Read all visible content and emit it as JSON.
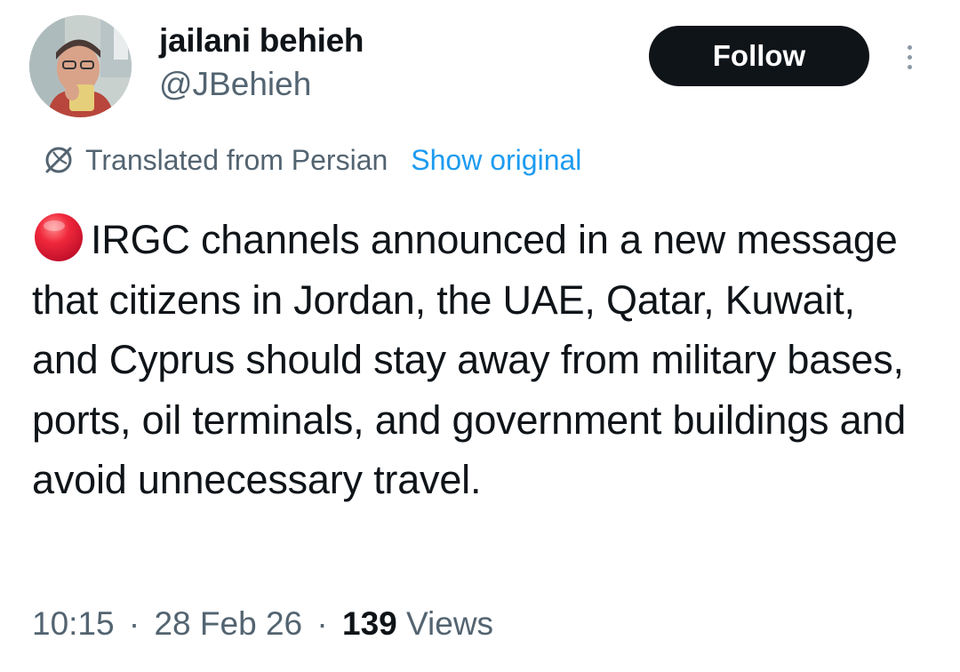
{
  "author": {
    "display_name": "jailani behieh",
    "handle": "@JBehieh"
  },
  "actions": {
    "follow_label": "Follow"
  },
  "translation": {
    "label": "Translated from Persian",
    "show_original_label": "Show original"
  },
  "tweet": {
    "emoji_icon": "red-circle-icon",
    "text": "IRGC channels announced in a new message that citizens in Jordan, the UAE, Qatar, Kuwait, and Cyprus should stay away from military bases, ports, oil terminals, and government buildings and avoid unnecessary travel."
  },
  "meta": {
    "time": "10:15",
    "date": "28 Feb 26",
    "separator": "·",
    "views_count": "139",
    "views_label": "Views"
  },
  "colors": {
    "text_primary": "#0f1419",
    "text_secondary": "#536471",
    "link_blue": "#1d9bf0",
    "follow_bg": "#0f1419"
  }
}
